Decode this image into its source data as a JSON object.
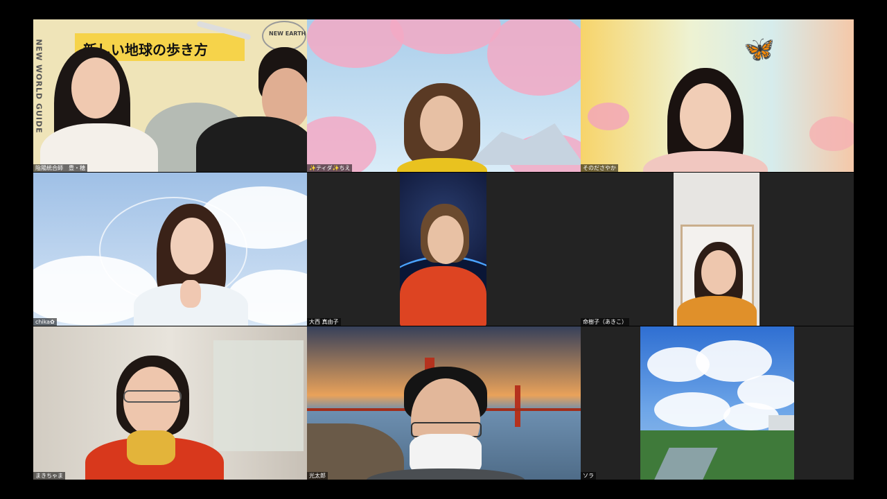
{
  "participants": [
    {
      "name": "陰陽統合師　豊・穂",
      "banner": "新しい地球の歩き方",
      "side_text": "NEW WORLD GUIDE",
      "stamp": "NEW EARTH"
    },
    {
      "name": "✨ティダ✨ちえ"
    },
    {
      "name": "そのださやか"
    },
    {
      "name": "chika✿"
    },
    {
      "name": "大西 真由子"
    },
    {
      "name": "命樹子（あきこ）"
    },
    {
      "name": "まきちゃま"
    },
    {
      "name": "光太郎"
    },
    {
      "name": "ソラ"
    }
  ]
}
